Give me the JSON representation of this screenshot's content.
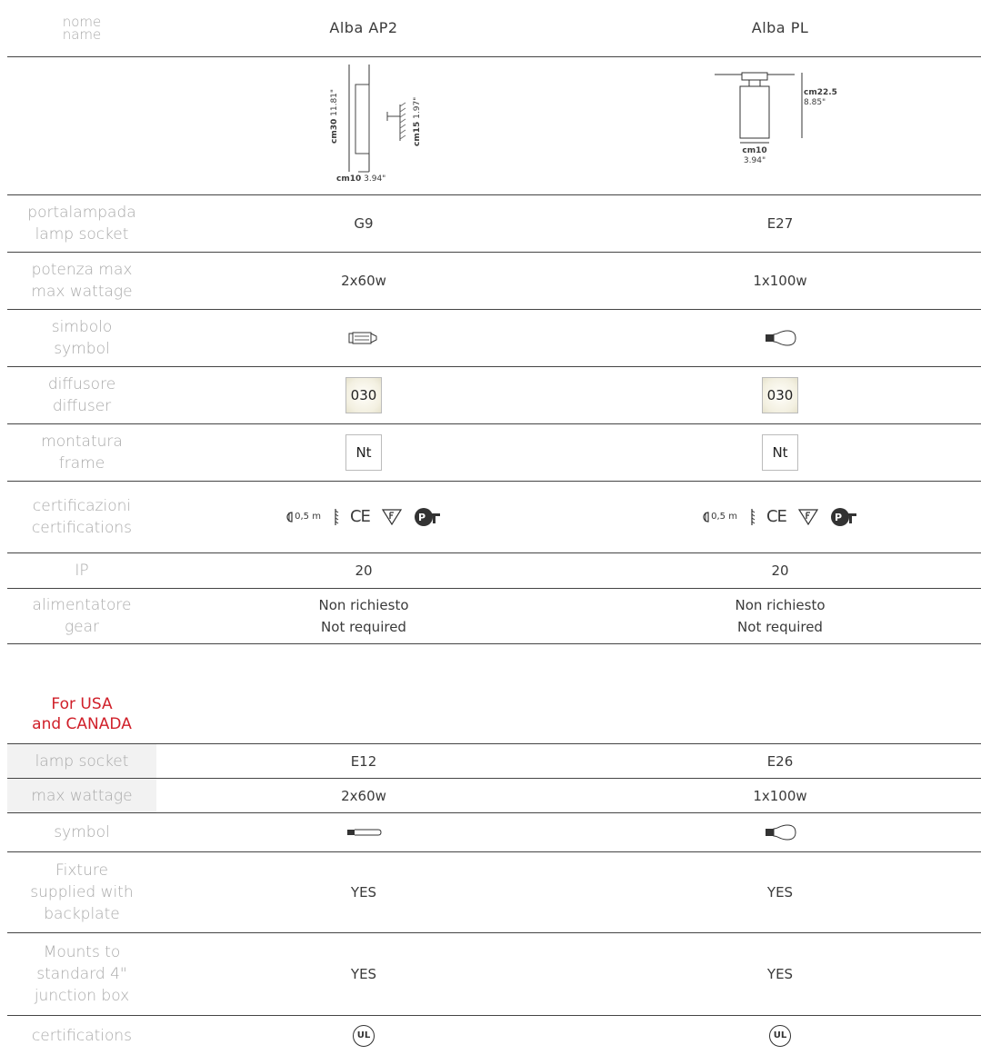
{
  "header": {
    "label_it": "nome",
    "label_en": "name",
    "product1": "Alba AP2",
    "product2": "Alba PL"
  },
  "drawings": {
    "p1_height": "cm30",
    "p1_height_in": "11.81\"",
    "p1_proj": "cm15",
    "p1_proj_in": "1.97\"",
    "p1_width": "cm10",
    "p1_width_in": "3.94\"",
    "p2_height": "cm22.5",
    "p2_height_in": "8.85\"",
    "p2_width": "cm10",
    "p2_width_in": "3.94\""
  },
  "rows": {
    "socket": {
      "it": "portalampada",
      "en": "lamp socket",
      "v1": "G9",
      "v2": "E27"
    },
    "wattage": {
      "it": "potenza max",
      "en": "max wattage",
      "v1": "2x60w",
      "v2": "1x100w"
    },
    "symbol": {
      "it": "simbolo",
      "en": "symbol",
      "icon1": "halogen-capsule-icon",
      "icon2": "bulb-icon"
    },
    "diffuser": {
      "it": "diffusore",
      "en": "diffuser",
      "v1": "030",
      "v2": "030"
    },
    "frame": {
      "it": "montatura",
      "en": "frame",
      "v1": "Nt",
      "v2": "Nt"
    },
    "certs": {
      "it": "certificazioni",
      "en": "certifications",
      "dist": "0,5 m",
      "ce": "CE"
    },
    "ip": {
      "label": "IP",
      "v1": "20",
      "v2": "20"
    },
    "gear": {
      "it": "alimentatore",
      "en": "gear",
      "v1_it": "Non richiesto",
      "v1_en": "Not required",
      "v2_it": "Non richiesto",
      "v2_en": "Not required"
    }
  },
  "usa": {
    "title_line1": "For USA",
    "title_line2": "and CANADA",
    "socket": {
      "label": "lamp socket",
      "v1": "E12",
      "v2": "E26"
    },
    "wattage": {
      "label": "max wattage",
      "v1": "2x60w",
      "v2": "1x100w"
    },
    "symbol": {
      "label": "symbol",
      "icon1": "candelabra-bulb-icon",
      "icon2": "bulb-icon"
    },
    "backplate": {
      "l1": "Fixture",
      "l2": "supplied with",
      "l3": "backplate",
      "v1": "YES",
      "v2": "YES"
    },
    "junction": {
      "l1": "Mounts to",
      "l2": "standard 4\"",
      "l3": "junction box",
      "v1": "YES",
      "v2": "YES"
    },
    "certs": {
      "label": "certifications",
      "mark": "UL"
    }
  }
}
